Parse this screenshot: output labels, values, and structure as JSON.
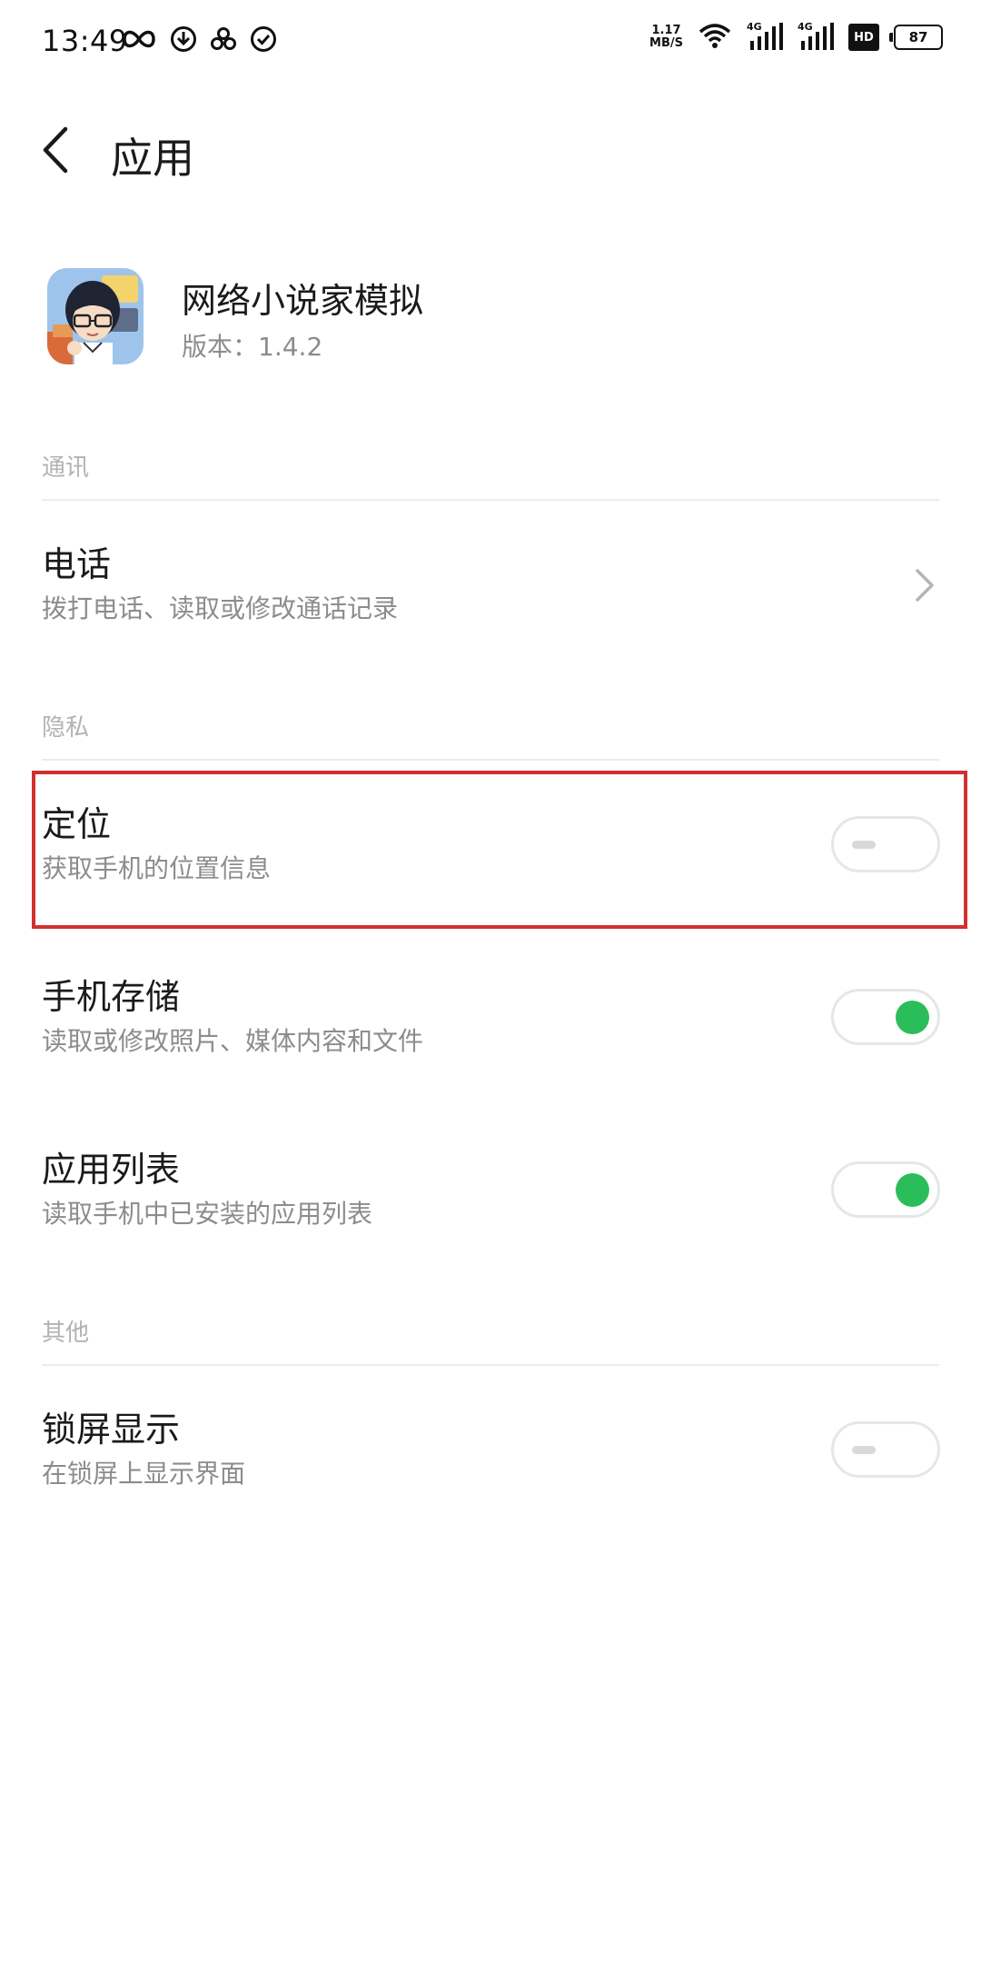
{
  "status_bar": {
    "time": "13:49",
    "net_speed_value": "1.17",
    "net_speed_unit": "MB/S",
    "signal1_label": "4G",
    "signal2_label": "4G",
    "hd_label": "HD",
    "battery_level": "87"
  },
  "header": {
    "title": "应用"
  },
  "app": {
    "name": "网络小说家模拟",
    "version_label": "版本：",
    "version_value": "1.4.2"
  },
  "sections": {
    "communication": "通讯",
    "privacy": "隐私",
    "other": "其他"
  },
  "permissions": {
    "phone": {
      "title": "电话",
      "subtitle": "拨打电话、读取或修改通话记录"
    },
    "location": {
      "title": "定位",
      "subtitle": "获取手机的位置信息",
      "enabled": false
    },
    "storage": {
      "title": "手机存储",
      "subtitle": "读取或修改照片、媒体内容和文件",
      "enabled": true
    },
    "app_list": {
      "title": "应用列表",
      "subtitle": "读取手机中已安装的应用列表",
      "enabled": true
    },
    "lock_screen": {
      "title": "锁屏显示",
      "subtitle": "在锁屏上显示界面",
      "enabled": false
    }
  },
  "colors": {
    "toggle_on": "#2bbd5a",
    "highlight": "#d32f2f",
    "divider": "#ececec",
    "secondary_text": "#8c8c8c"
  }
}
